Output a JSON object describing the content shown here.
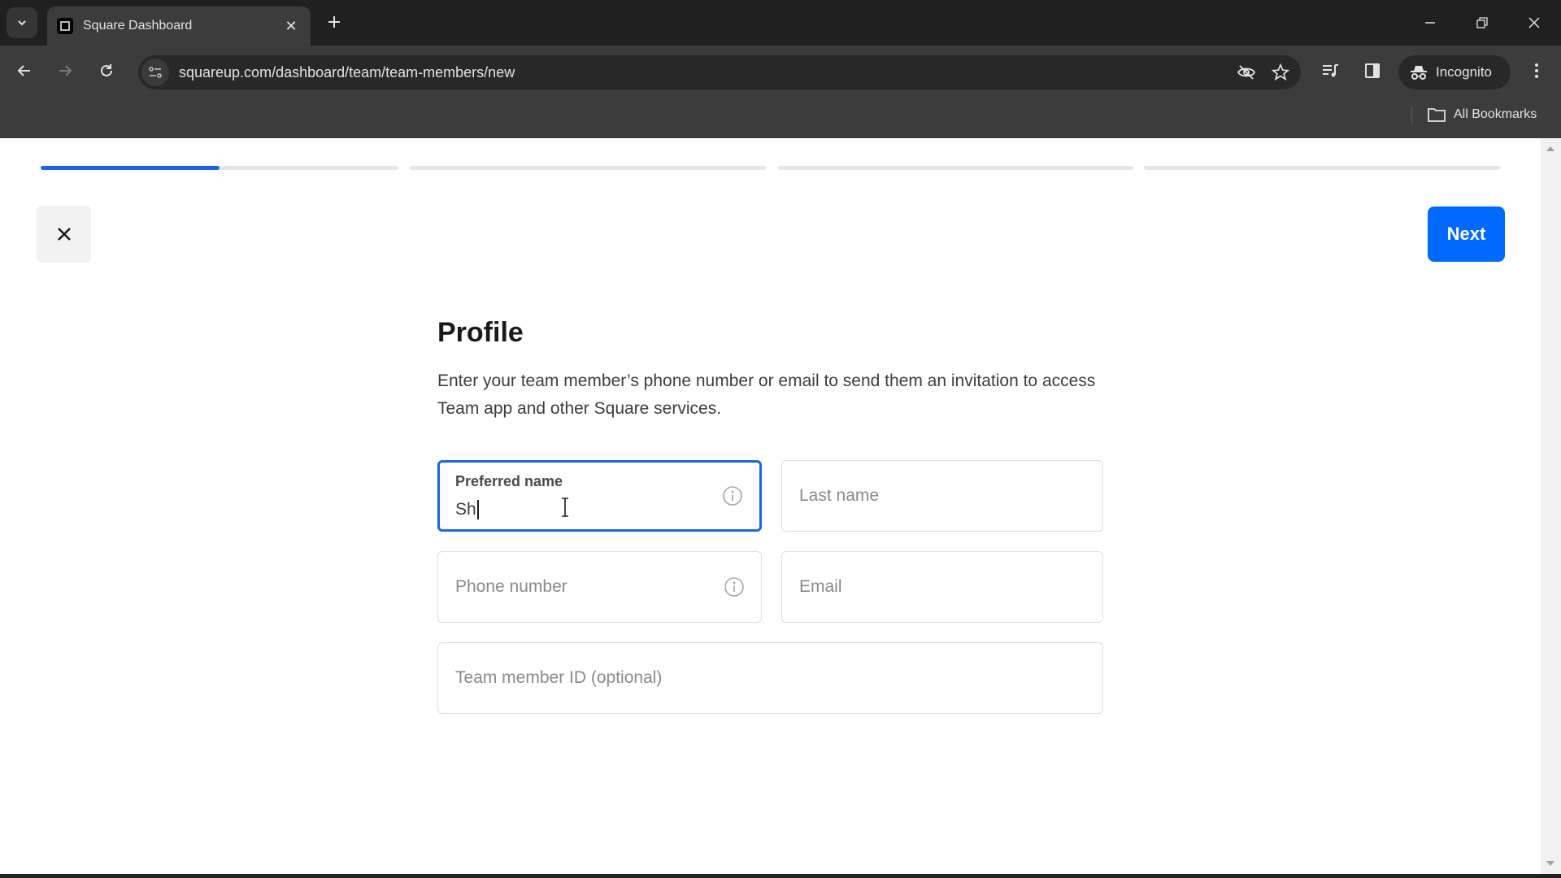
{
  "browser": {
    "tab": {
      "title": "Square Dashboard"
    },
    "url": "squareup.com/dashboard/team/team-members/new",
    "profile_label": "Incognito",
    "bookmarks_label": "All Bookmarks",
    "icons": {
      "tab_search": "chevron-down-icon",
      "new_tab": "plus-icon",
      "back": "arrow-left-icon",
      "forward": "arrow-right-icon",
      "reload": "reload-icon",
      "site_info": "tune-icon",
      "tracking": "eye-off-icon",
      "bookmark": "star-icon",
      "media": "media-queue-icon",
      "side_panel": "side-panel-icon",
      "menu": "kebab-menu-icon"
    }
  },
  "wizard": {
    "steps_total": 4,
    "current_step": 1,
    "current_step_progress": 0.5,
    "close_label": "×",
    "next_label": "Next",
    "accent_color": "#006aff"
  },
  "profile": {
    "title": "Profile",
    "description": "Enter your team member’s phone number or email to send them an invitation to access Team app and other Square services.",
    "fields": {
      "preferred_name": {
        "label": "Preferred name",
        "value": "Sh"
      },
      "last_name": {
        "placeholder": "Last name",
        "value": ""
      },
      "phone_number": {
        "placeholder": "Phone number",
        "value": ""
      },
      "email": {
        "placeholder": "Email",
        "value": ""
      },
      "team_member_id": {
        "placeholder": "Team member ID (optional)",
        "value": ""
      }
    }
  }
}
